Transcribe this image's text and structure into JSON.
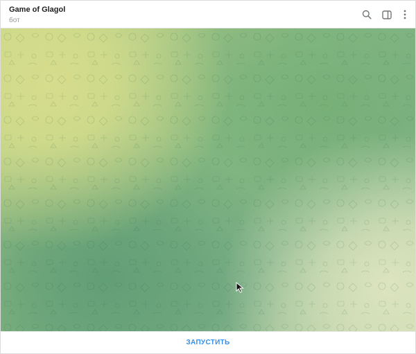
{
  "chat": {
    "title": "Game of Glagol",
    "subtitle": "бот"
  },
  "header": {
    "icons": [
      "search-icon",
      "sidebar-toggle-icon",
      "more-vertical-icon"
    ]
  },
  "bottom_bar": {
    "start_label": "ЗАПУСТИТЬ"
  },
  "colors": {
    "accent": "#3390ec",
    "title": "#1f1f1f",
    "subtitle": "#9a9a9a",
    "bg_yellow": "#d6dd8c",
    "bg_green": "#86b883",
    "bg_dark_green": "#629e76",
    "bg_pale": "#dce4be"
  }
}
